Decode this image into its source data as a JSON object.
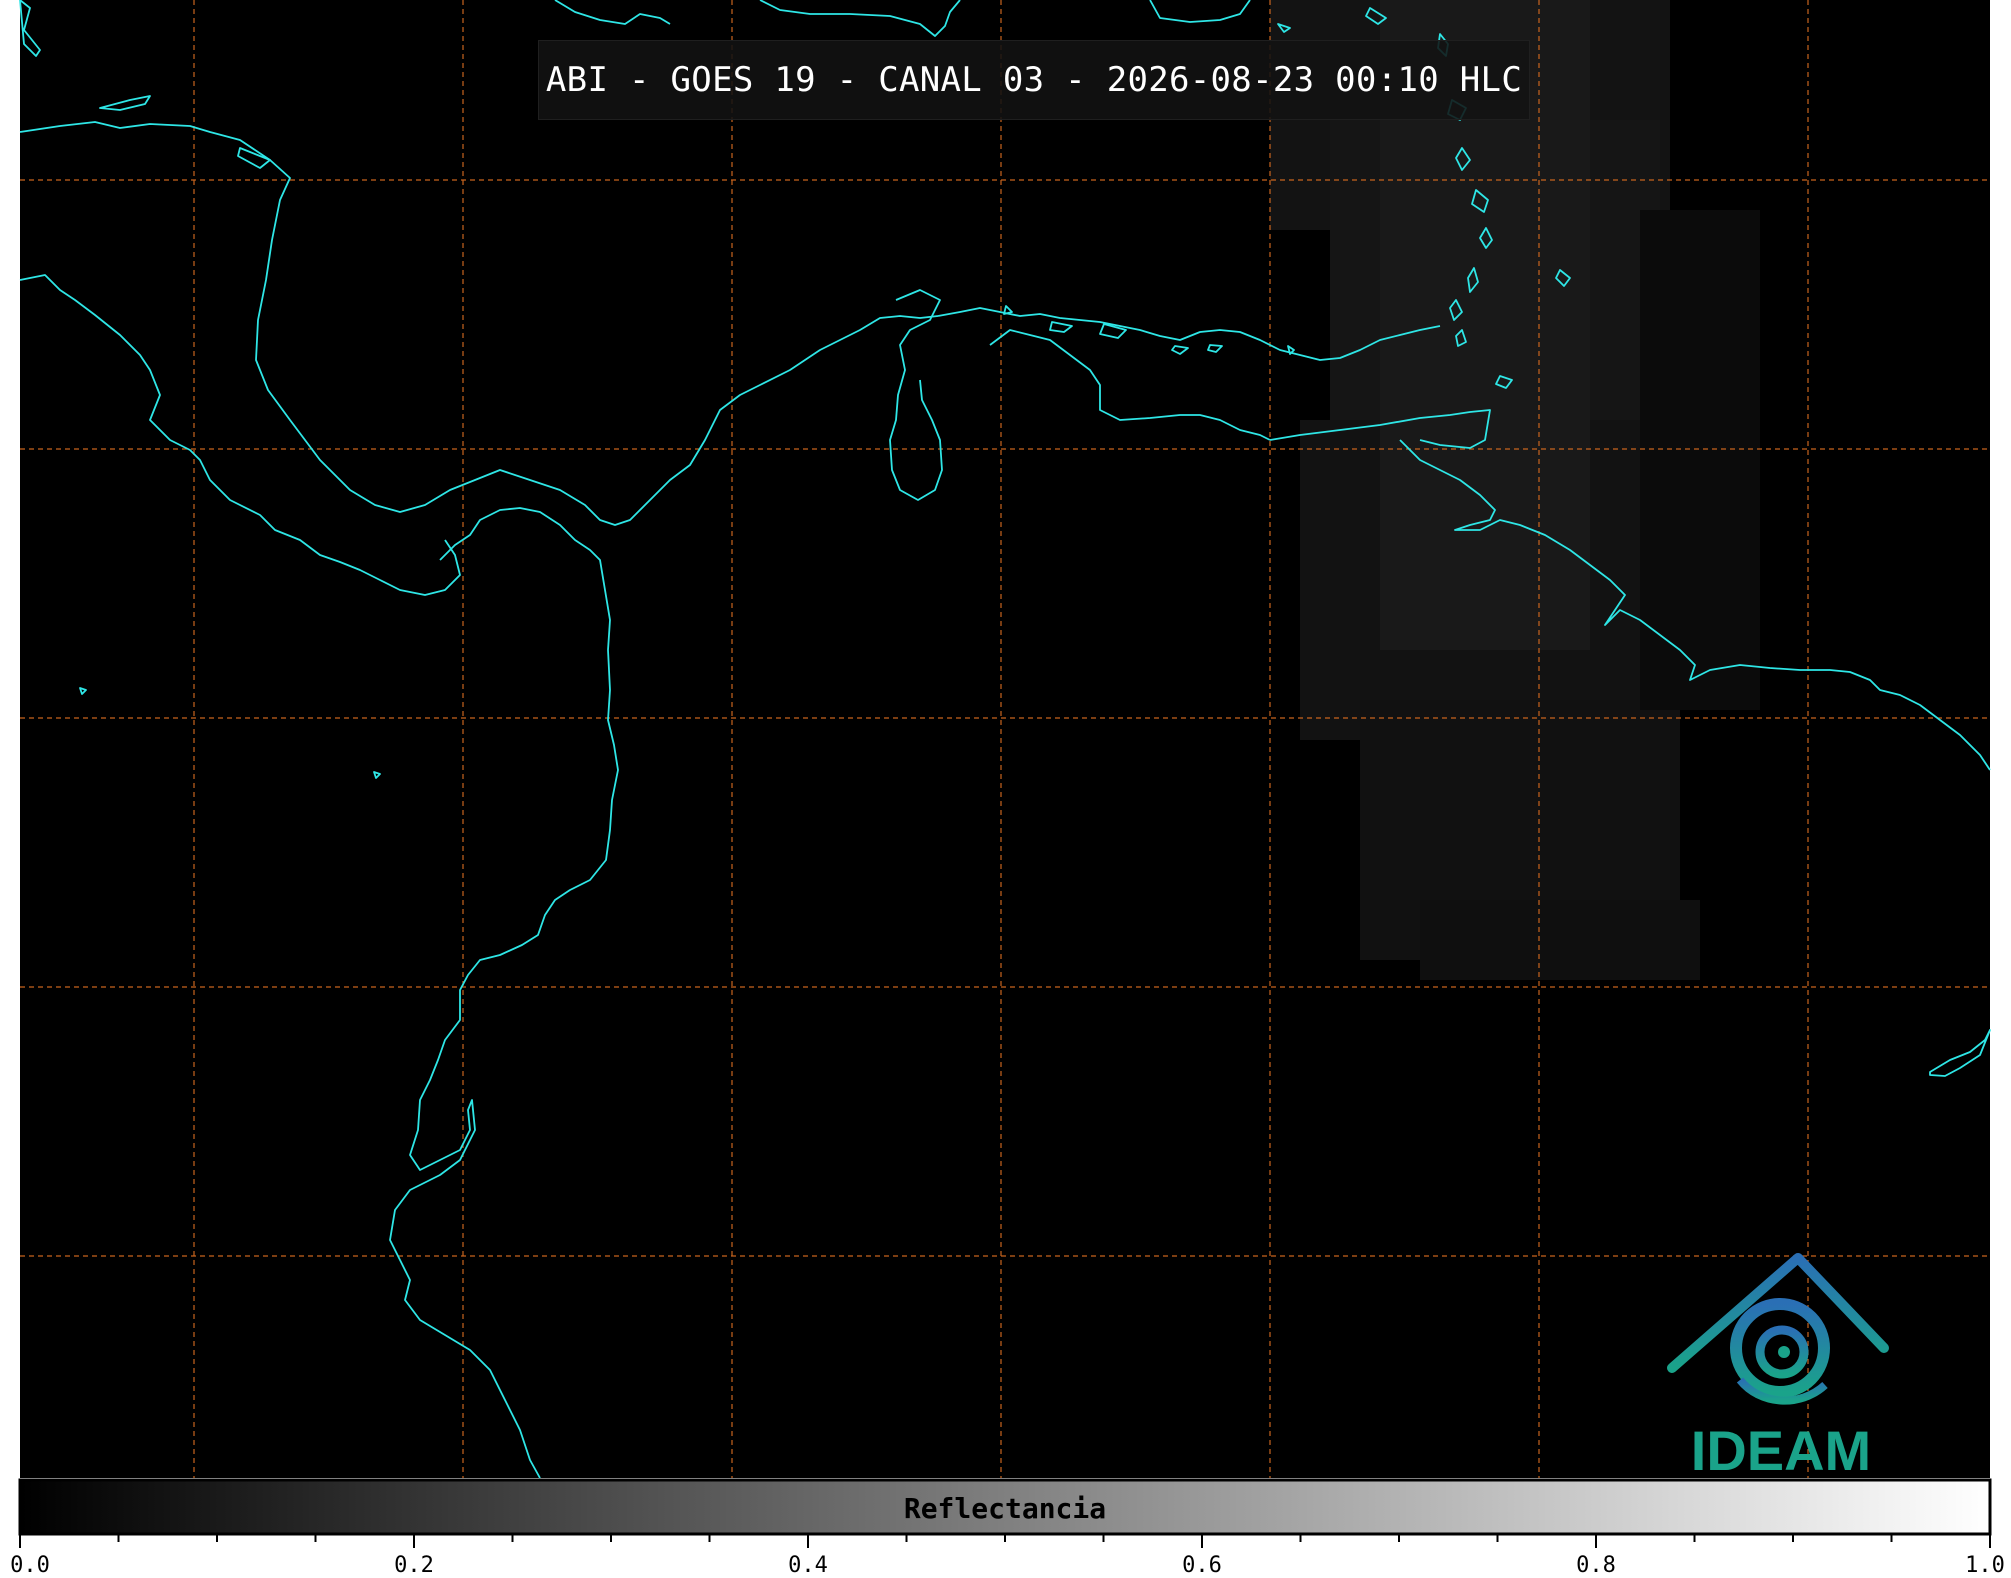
{
  "title": "ABI - GOES 19 - CANAL 03 - 2026-08-23 00:10 HLC",
  "colorbar": {
    "label": "Reflectancia",
    "ticks": [
      "0.0",
      "0.2",
      "0.4",
      "0.6",
      "0.8",
      "1.0"
    ],
    "range": [
      0.0,
      1.0
    ],
    "colors": {
      "low": "#000000",
      "high": "#ffffff"
    }
  },
  "logo": {
    "text": "IDEAM",
    "colors": {
      "top": "#2a6fb5",
      "bottom": "#1aa38a"
    }
  },
  "map": {
    "background": "#000000",
    "coastline_color": "#2ee6e6",
    "gridline_color": "#c8641e",
    "gridlines": true
  }
}
